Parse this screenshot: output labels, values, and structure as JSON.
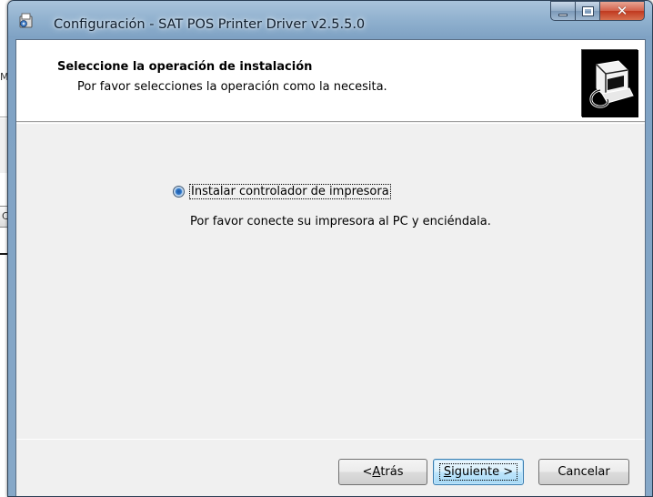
{
  "background_window": {
    "partial_text": "My",
    "partial_button": "C"
  },
  "window": {
    "title": "Configuración - SAT POS Printer Driver v2.5.5.0",
    "icon": "installer-app-icon",
    "caption_buttons": {
      "minimize_icon": "minimize-icon",
      "maximize_icon": "maximize-icon",
      "close_icon": "close-icon",
      "close_glyph": "✕"
    }
  },
  "header": {
    "title": "Seleccione la operación de instalación",
    "subtitle": "Por favor selecciones la operación como la necesita.",
    "logo_icon": "printer-logo-icon"
  },
  "options": [
    {
      "label": "Instalar controlador de impresora",
      "description": "Por favor conecte su impresora al PC y enciéndala.",
      "selected": true
    }
  ],
  "buttons": {
    "back_prefix": "< ",
    "back_mnemonic": "A",
    "back_rest": "trás",
    "next_mnemonic": "S",
    "next_rest": "iguiente >",
    "cancel": "Cancelar"
  },
  "colors": {
    "titlebar": "#8fb0ce",
    "client_bg": "#f0f0f0",
    "header_bg": "#ffffff",
    "close_button": "#c0391f",
    "focused_button_border": "#3c7fb1"
  }
}
